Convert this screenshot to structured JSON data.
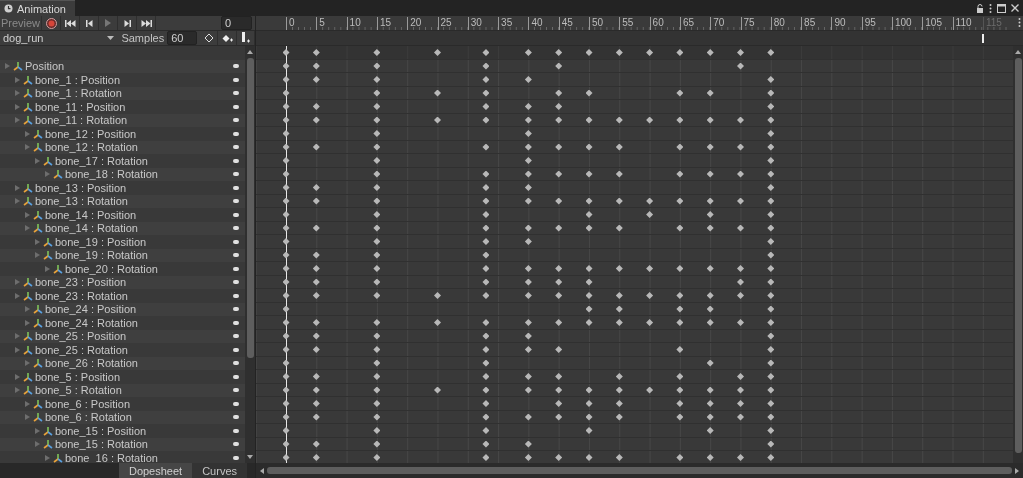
{
  "window": {
    "title": "Animation"
  },
  "toolbar": {
    "preview": "Preview",
    "frame": "0"
  },
  "clip": {
    "name": "dog_run",
    "samples_label": "Samples",
    "samples": "60"
  },
  "ruler": [
    {
      "text": "0",
      "dimmed": false
    },
    {
      "text": "5",
      "dimmed": false
    },
    {
      "text": "10",
      "dimmed": false
    },
    {
      "text": "15",
      "dimmed": false
    },
    {
      "text": "20",
      "dimmed": false
    },
    {
      "text": "25",
      "dimmed": false
    },
    {
      "text": "30",
      "dimmed": false
    },
    {
      "text": "35",
      "dimmed": false
    },
    {
      "text": "40",
      "dimmed": false
    },
    {
      "text": "45",
      "dimmed": false
    },
    {
      "text": "50",
      "dimmed": false
    },
    {
      "text": "55",
      "dimmed": false
    },
    {
      "text": "60",
      "dimmed": false
    },
    {
      "text": "65",
      "dimmed": false
    },
    {
      "text": "70",
      "dimmed": false
    },
    {
      "text": "75",
      "dimmed": false
    },
    {
      "text": "80",
      "dimmed": false
    },
    {
      "text": "85",
      "dimmed": false
    },
    {
      "text": "90",
      "dimmed": false
    },
    {
      "text": "95",
      "dimmed": false
    },
    {
      "text": "100",
      "dimmed": false
    },
    {
      "text": "105",
      "dimmed": false
    },
    {
      "text": "110",
      "dimmed": false
    },
    {
      "text": "115",
      "dimmed": true
    }
  ],
  "event_marker": true,
  "summary_keys": [
    true,
    true,
    true,
    true,
    true,
    true,
    true,
    true,
    true,
    true,
    true,
    true,
    true,
    true
  ],
  "tracks": [
    {
      "label": "Position",
      "expanded": false,
      "keys": [
        true,
        true,
        true,
        false,
        true,
        false,
        true,
        false,
        false,
        false,
        false,
        false,
        true,
        false
      ],
      "children": [
        {
          "label": "bone_1 : Position",
          "expanded": false,
          "keys": [
            true,
            true,
            true,
            false,
            true,
            true,
            false,
            false,
            false,
            false,
            false,
            false,
            false,
            true
          ]
        },
        {
          "label": "bone_1 : Rotation",
          "expanded": false,
          "keys": [
            true,
            false,
            true,
            true,
            true,
            false,
            true,
            true,
            false,
            false,
            true,
            true,
            false,
            true
          ]
        },
        {
          "label": "bone_11 : Position",
          "expanded": false,
          "keys": [
            true,
            true,
            true,
            false,
            true,
            true,
            true,
            false,
            false,
            false,
            false,
            false,
            false,
            true
          ]
        },
        {
          "label": "bone_11 : Rotation",
          "expanded": false,
          "keys": [
            true,
            true,
            true,
            true,
            true,
            true,
            true,
            true,
            true,
            true,
            true,
            true,
            true,
            true
          ],
          "children": [
            {
              "label": "bone_12 : Position",
              "expanded": false,
              "keys": [
                true,
                false,
                true,
                false,
                false,
                true,
                false,
                false,
                false,
                false,
                false,
                false,
                false,
                true
              ]
            },
            {
              "label": "bone_12 : Rotation",
              "expanded": false,
              "keys": [
                true,
                true,
                true,
                false,
                true,
                true,
                true,
                true,
                true,
                false,
                true,
                true,
                true,
                true
              ],
              "children": [
                {
                  "label": "bone_17 : Rotation",
                  "expanded": false,
                  "keys": [
                    true,
                    false,
                    true,
                    false,
                    false,
                    true,
                    false,
                    false,
                    false,
                    false,
                    false,
                    false,
                    false,
                    true
                  ],
                  "children": [
                    {
                      "label": "bone_18 : Rotation",
                      "expanded": false,
                      "keys": [
                        true,
                        false,
                        true,
                        false,
                        true,
                        true,
                        true,
                        true,
                        true,
                        false,
                        true,
                        true,
                        true,
                        true
                      ]
                    }
                  ]
                }
              ]
            }
          ]
        },
        {
          "label": "bone_13 : Position",
          "expanded": false,
          "keys": [
            true,
            true,
            true,
            false,
            true,
            true,
            false,
            false,
            false,
            false,
            false,
            false,
            false,
            true
          ]
        },
        {
          "label": "bone_13 : Rotation",
          "expanded": false,
          "keys": [
            true,
            true,
            true,
            false,
            true,
            true,
            true,
            true,
            true,
            true,
            true,
            true,
            true,
            true
          ],
          "children": [
            {
              "label": "bone_14 : Position",
              "expanded": false,
              "keys": [
                true,
                false,
                true,
                false,
                true,
                false,
                false,
                true,
                false,
                true,
                false,
                true,
                false,
                true
              ]
            },
            {
              "label": "bone_14 : Rotation",
              "expanded": false,
              "keys": [
                true,
                true,
                true,
                false,
                true,
                true,
                true,
                true,
                true,
                false,
                true,
                true,
                true,
                true
              ],
              "children": [
                {
                  "label": "bone_19 : Position",
                  "expanded": false,
                  "keys": [
                    true,
                    false,
                    true,
                    false,
                    true,
                    true,
                    false,
                    false,
                    false,
                    false,
                    false,
                    false,
                    false,
                    true
                  ]
                },
                {
                  "label": "bone_19 : Rotation",
                  "expanded": false,
                  "keys": [
                    true,
                    true,
                    true,
                    false,
                    true,
                    false,
                    false,
                    false,
                    false,
                    false,
                    false,
                    false,
                    false,
                    true
                  ],
                  "children": [
                    {
                      "label": "bone_20 : Rotation",
                      "expanded": false,
                      "keys": [
                        true,
                        true,
                        true,
                        false,
                        true,
                        true,
                        true,
                        true,
                        true,
                        true,
                        true,
                        true,
                        true,
                        true
                      ]
                    }
                  ]
                }
              ]
            }
          ]
        },
        {
          "label": "bone_23 : Position",
          "expanded": false,
          "keys": [
            true,
            true,
            true,
            false,
            true,
            true,
            true,
            true,
            false,
            false,
            false,
            false,
            true,
            true
          ]
        },
        {
          "label": "bone_23 : Rotation",
          "expanded": false,
          "keys": [
            true,
            true,
            true,
            true,
            true,
            true,
            true,
            true,
            true,
            true,
            true,
            true,
            true,
            true
          ],
          "children": [
            {
              "label": "bone_24 : Position",
              "expanded": false,
              "keys": [
                true,
                false,
                false,
                false,
                false,
                false,
                false,
                true,
                true,
                false,
                true,
                true,
                false,
                true
              ]
            },
            {
              "label": "bone_24 : Rotation",
              "expanded": false,
              "keys": [
                true,
                true,
                true,
                true,
                true,
                true,
                true,
                true,
                true,
                true,
                true,
                true,
                true,
                true
              ]
            }
          ]
        },
        {
          "label": "bone_25 : Position",
          "expanded": false,
          "keys": [
            true,
            true,
            true,
            false,
            true,
            true,
            false,
            false,
            false,
            false,
            false,
            false,
            false,
            true
          ]
        },
        {
          "label": "bone_25 : Rotation",
          "expanded": false,
          "keys": [
            true,
            true,
            true,
            false,
            true,
            true,
            true,
            false,
            false,
            false,
            true,
            false,
            false,
            true
          ],
          "children": [
            {
              "label": "bone_26 : Rotation",
              "expanded": false,
              "keys": [
                true,
                false,
                true,
                false,
                true,
                false,
                false,
                false,
                false,
                false,
                false,
                true,
                false,
                true
              ]
            }
          ]
        },
        {
          "label": "bone_5 : Position",
          "expanded": false,
          "keys": [
            true,
            true,
            true,
            false,
            true,
            true,
            true,
            false,
            true,
            false,
            true,
            false,
            true,
            true
          ]
        },
        {
          "label": "bone_5 : Rotation",
          "expanded": false,
          "keys": [
            true,
            true,
            true,
            true,
            true,
            true,
            true,
            true,
            true,
            true,
            true,
            true,
            true,
            true
          ],
          "children": [
            {
              "label": "bone_6 : Position",
              "expanded": false,
              "keys": [
                true,
                true,
                true,
                false,
                true,
                false,
                true,
                true,
                true,
                false,
                true,
                true,
                true,
                true
              ]
            },
            {
              "label": "bone_6 : Rotation",
              "expanded": false,
              "keys": [
                true,
                true,
                true,
                false,
                true,
                true,
                true,
                true,
                true,
                false,
                true,
                true,
                true,
                true
              ],
              "children": [
                {
                  "label": "bone_15 : Position",
                  "expanded": false,
                  "keys": [
                    true,
                    false,
                    true,
                    false,
                    true,
                    false,
                    false,
                    true,
                    false,
                    false,
                    false,
                    true,
                    false,
                    true
                  ]
                },
                {
                  "label": "bone_15 : Rotation",
                  "expanded": false,
                  "keys": [
                    true,
                    true,
                    true,
                    false,
                    true,
                    true,
                    false,
                    false,
                    false,
                    false,
                    false,
                    false,
                    false,
                    true
                  ],
                  "children": [
                    {
                      "label": "bone_16 : Rotation",
                      "expanded": false,
                      "keys": [
                        true,
                        true,
                        true,
                        false,
                        true,
                        true,
                        true,
                        true,
                        true,
                        false,
                        true,
                        true,
                        true,
                        true
                      ]
                    }
                  ]
                }
              ]
            }
          ]
        }
      ]
    }
  ],
  "view_tabs": [
    {
      "label": "Dopesheet",
      "selected": true
    },
    {
      "label": "Curves",
      "selected": false
    }
  ]
}
